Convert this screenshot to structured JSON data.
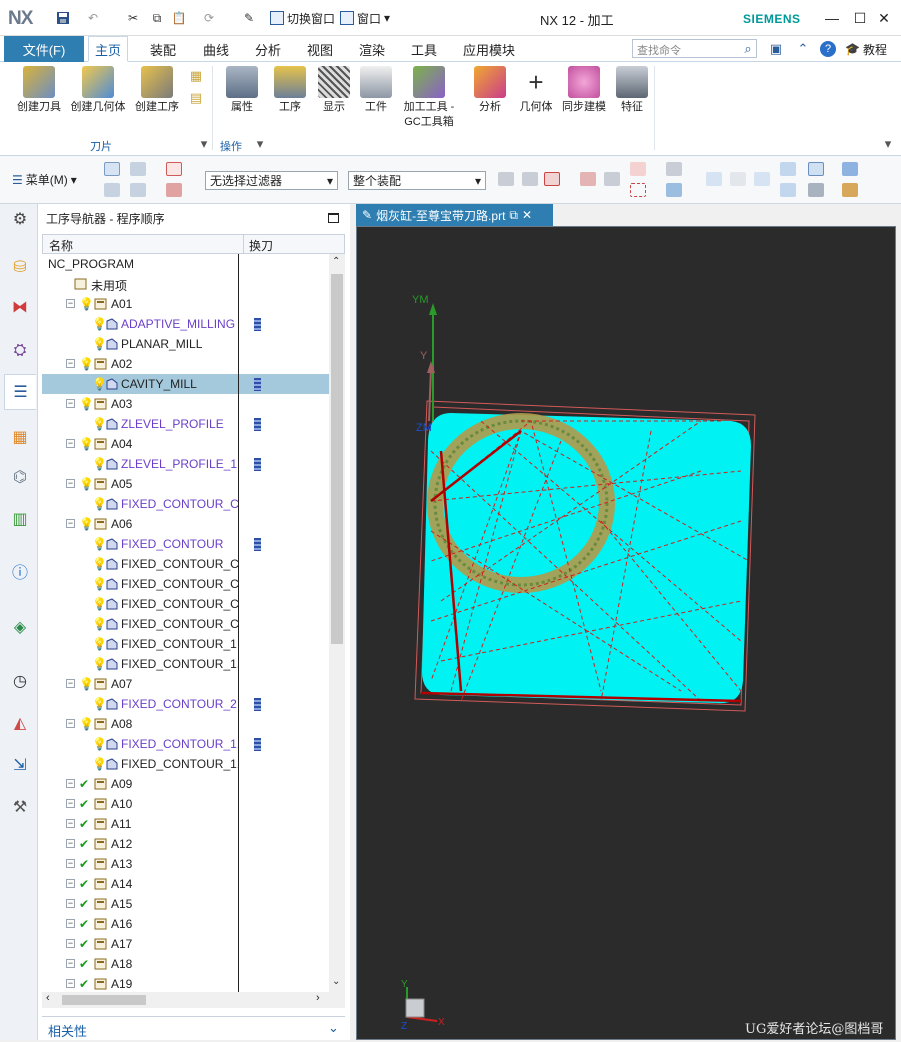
{
  "app": {
    "logo": "NX",
    "title": "NX 12 - 加工",
    "brand": "SIEMENS"
  },
  "quick_access": {
    "switch_window": "切换窗口",
    "window": "窗口"
  },
  "ribbon_tabs": {
    "file": "文件(F)",
    "tabs": [
      "主页",
      "装配",
      "曲线",
      "分析",
      "视图",
      "渲染",
      "工具",
      "应用模块"
    ],
    "active": "主页",
    "search_placeholder": "查找命令",
    "tutorial": "教程"
  },
  "ribbon": {
    "tool_group": {
      "label": "刀片",
      "items": [
        "创建刀具",
        "创建几何体",
        "创建工序"
      ]
    },
    "ops_group": {
      "label": "操作",
      "items": [
        "属性",
        "工序",
        "显示",
        "工件",
        "加工工具 - GC工具箱",
        "分析",
        "几何体",
        "同步建模",
        "特征"
      ]
    }
  },
  "toolbar2": {
    "menu": "菜单(M)",
    "filter": "无选择过滤器",
    "scope": "整个装配"
  },
  "navigator": {
    "title": "工序导航器 - 程序顺序",
    "col_name": "名称",
    "col_tool": "换刀",
    "rows": [
      {
        "label": "NC_PROGRAM",
        "indent": 0,
        "kind": "root"
      },
      {
        "label": "未用项",
        "indent": 1,
        "kind": "folder"
      },
      {
        "label": "A01",
        "indent": 1,
        "kind": "group",
        "state": "bulb"
      },
      {
        "label": "ADAPTIVE_MILLING",
        "indent": 2,
        "kind": "op",
        "purple": true,
        "tool": true
      },
      {
        "label": "PLANAR_MILL",
        "indent": 2,
        "kind": "op",
        "purple": false,
        "tool": false
      },
      {
        "label": "A02",
        "indent": 1,
        "kind": "group",
        "state": "bulb"
      },
      {
        "label": "CAVITY_MILL",
        "indent": 2,
        "kind": "op",
        "purple": false,
        "tool": true,
        "selected": true
      },
      {
        "label": "A03",
        "indent": 1,
        "kind": "group",
        "state": "bulb"
      },
      {
        "label": "ZLEVEL_PROFILE",
        "indent": 2,
        "kind": "op",
        "purple": true,
        "tool": true
      },
      {
        "label": "A04",
        "indent": 1,
        "kind": "group",
        "state": "bulb"
      },
      {
        "label": "ZLEVEL_PROFILE_1",
        "indent": 2,
        "kind": "op",
        "purple": true,
        "tool": true
      },
      {
        "label": "A05",
        "indent": 1,
        "kind": "group",
        "state": "bulb"
      },
      {
        "label": "FIXED_CONTOUR_C...",
        "indent": 2,
        "kind": "op",
        "purple": true,
        "tool": false
      },
      {
        "label": "A06",
        "indent": 1,
        "kind": "group",
        "state": "bulb"
      },
      {
        "label": "FIXED_CONTOUR",
        "indent": 2,
        "kind": "op",
        "purple": true,
        "tool": true
      },
      {
        "label": "FIXED_CONTOUR_C...",
        "indent": 2,
        "kind": "op",
        "purple": false,
        "tool": false
      },
      {
        "label": "FIXED_CONTOUR_C...",
        "indent": 2,
        "kind": "op",
        "purple": false,
        "tool": false
      },
      {
        "label": "FIXED_CONTOUR_C...",
        "indent": 2,
        "kind": "op",
        "purple": false,
        "tool": false
      },
      {
        "label": "FIXED_CONTOUR_C...",
        "indent": 2,
        "kind": "op",
        "purple": false,
        "tool": false
      },
      {
        "label": "FIXED_CONTOUR_1",
        "indent": 2,
        "kind": "op",
        "purple": false,
        "tool": false
      },
      {
        "label": "FIXED_CONTOUR_1...",
        "indent": 2,
        "kind": "op",
        "purple": false,
        "tool": false
      },
      {
        "label": "A07",
        "indent": 1,
        "kind": "group",
        "state": "bulb"
      },
      {
        "label": "FIXED_CONTOUR_2",
        "indent": 2,
        "kind": "op",
        "purple": true,
        "tool": true
      },
      {
        "label": "A08",
        "indent": 1,
        "kind": "group",
        "state": "bulb"
      },
      {
        "label": "FIXED_CONTOUR_1...",
        "indent": 2,
        "kind": "op",
        "purple": true,
        "tool": true
      },
      {
        "label": "FIXED_CONTOUR_1...",
        "indent": 2,
        "kind": "op",
        "purple": false,
        "tool": false
      },
      {
        "label": "A09",
        "indent": 1,
        "kind": "group",
        "state": "check"
      },
      {
        "label": "A10",
        "indent": 1,
        "kind": "group",
        "state": "check"
      },
      {
        "label": "A11",
        "indent": 1,
        "kind": "group",
        "state": "check"
      },
      {
        "label": "A12",
        "indent": 1,
        "kind": "group",
        "state": "check"
      },
      {
        "label": "A13",
        "indent": 1,
        "kind": "group",
        "state": "check"
      },
      {
        "label": "A14",
        "indent": 1,
        "kind": "group",
        "state": "check"
      },
      {
        "label": "A15",
        "indent": 1,
        "kind": "group",
        "state": "check"
      },
      {
        "label": "A16",
        "indent": 1,
        "kind": "group",
        "state": "check"
      },
      {
        "label": "A17",
        "indent": 1,
        "kind": "group",
        "state": "check"
      },
      {
        "label": "A18",
        "indent": 1,
        "kind": "group",
        "state": "check"
      },
      {
        "label": "A19",
        "indent": 1,
        "kind": "group",
        "state": "check"
      }
    ],
    "related": "相关性"
  },
  "viewport": {
    "tab_title": "烟灰缸-至尊宝带刀路.prt",
    "axis_ym": "YM",
    "axis_y": "Y",
    "axis_zm": "ZM",
    "triad_y": "Y",
    "triad_x": "X",
    "triad_z": "Z"
  },
  "watermark": "UG爱好者论坛@图档哥"
}
